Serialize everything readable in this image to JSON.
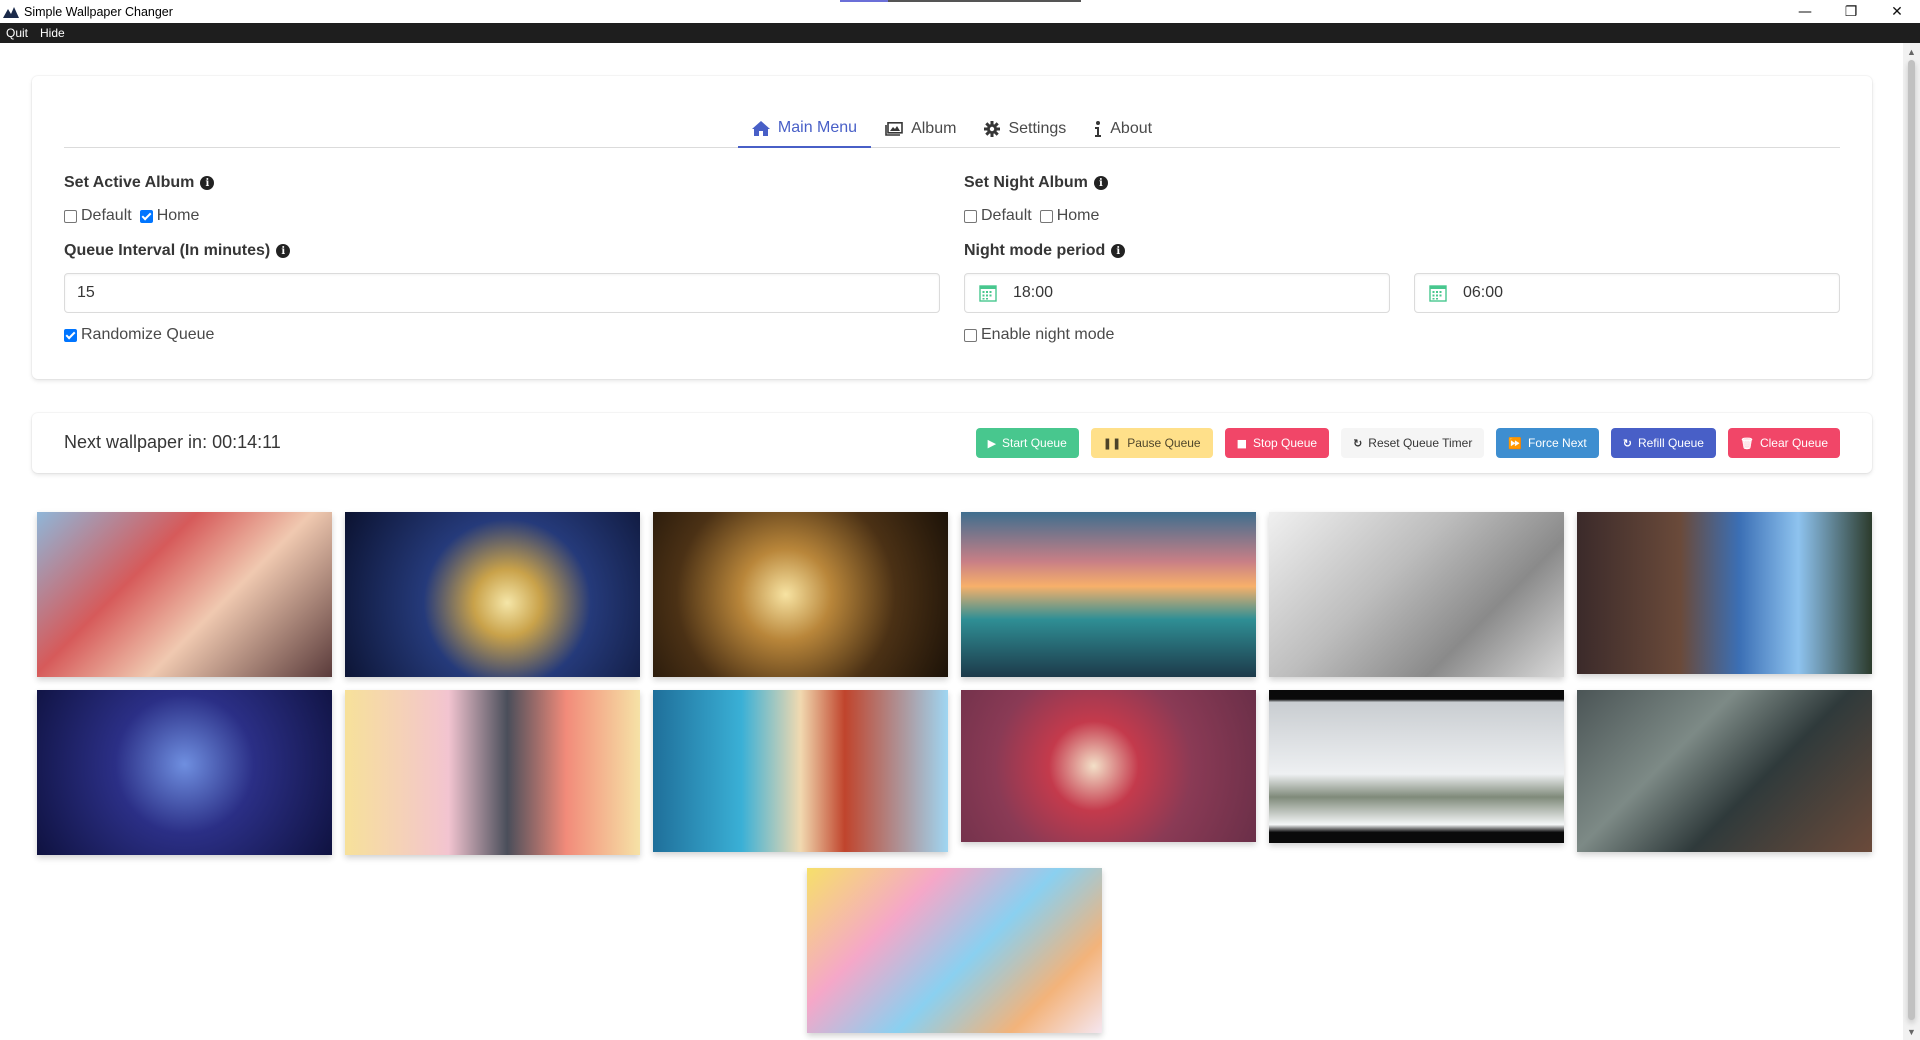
{
  "window": {
    "title": "Simple Wallpaper Changer",
    "minimize": "—",
    "restore": "❐",
    "close": "✕"
  },
  "menubar": {
    "quit": "Quit",
    "hide": "Hide"
  },
  "tabs": [
    {
      "label": "Main Menu",
      "icon": "home-icon",
      "active": true
    },
    {
      "label": "Album",
      "icon": "images-icon",
      "active": false
    },
    {
      "label": "Settings",
      "icon": "gear-icon",
      "active": false
    },
    {
      "label": "About",
      "icon": "info-icon",
      "active": false
    }
  ],
  "active_album": {
    "label": "Set Active Album",
    "options": [
      {
        "label": "Default",
        "checked": false
      },
      {
        "label": "Home",
        "checked": true
      }
    ]
  },
  "night_album": {
    "label": "Set Night Album",
    "options": [
      {
        "label": "Default",
        "checked": false
      },
      {
        "label": "Home",
        "checked": false
      }
    ]
  },
  "queue_interval": {
    "label": "Queue Interval (In minutes)",
    "value": "15"
  },
  "night_mode": {
    "label": "Night mode period",
    "start": "18:00",
    "end": "06:00"
  },
  "randomize": {
    "label": "Randomize Queue",
    "checked": true
  },
  "enable_night": {
    "label": "Enable night mode",
    "checked": false
  },
  "queue": {
    "next_text": "Next wallpaper in: 00:14:11",
    "buttons": {
      "start": "Start Queue",
      "pause": "Pause Queue",
      "stop": "Stop Queue",
      "reset": "Reset Queue Timer",
      "force": "Force Next",
      "refill": "Refill Queue",
      "clear": "Clear Queue"
    }
  },
  "colors": {
    "primary": "#485fc7",
    "success": "#48c78e",
    "warning": "#ffe08a",
    "danger": "#f14668",
    "info": "#3e8ed0"
  }
}
